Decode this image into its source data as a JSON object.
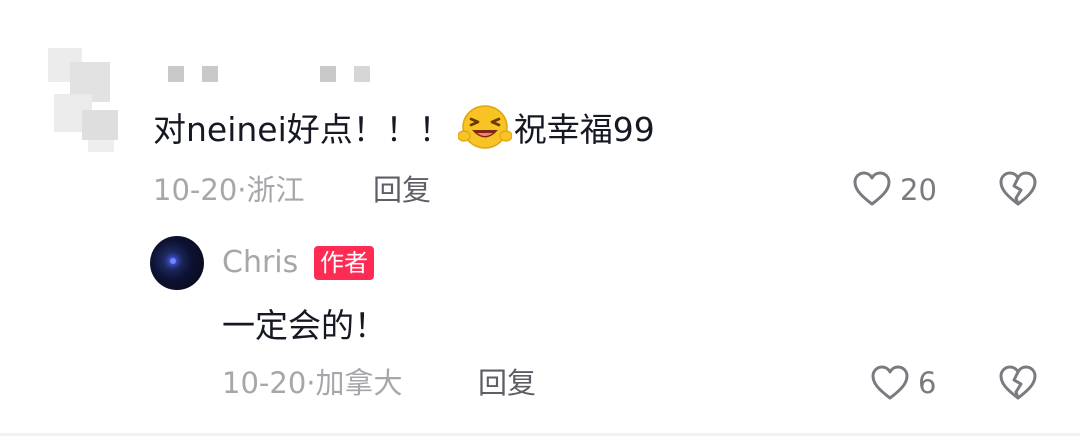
{
  "comment": {
    "text_before_emoji": "对neinei好点！！！",
    "emoji_icon": "grinning-squinting-face-emoji",
    "text_after_emoji": "祝幸福99",
    "date": "10-20",
    "separator": "·",
    "location": "浙江",
    "reply_label": "回复",
    "like_count": "20"
  },
  "reply": {
    "username": "Chris",
    "badge": "作者",
    "text": "一定会的！",
    "date": "10-20",
    "separator": "·",
    "location": "加拿大",
    "reply_label": "回复",
    "like_count": "6"
  },
  "colors": {
    "badge": "#fe2c55",
    "meta": "#a6a7ab",
    "text": "#161823"
  }
}
